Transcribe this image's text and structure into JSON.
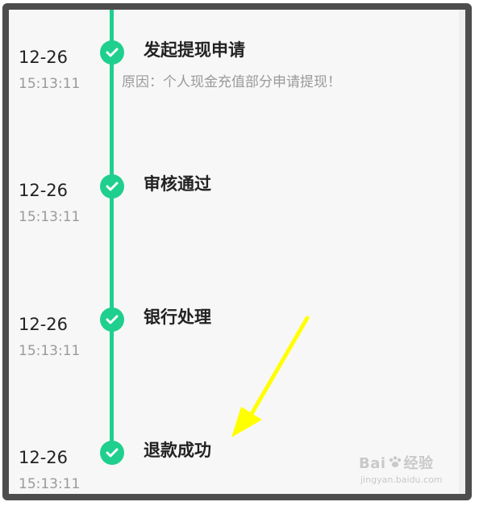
{
  "timeline": {
    "steps": [
      {
        "date": "12-26",
        "time": "15:13:11",
        "title": "发起提现申请",
        "reason": "原因：个人现金充值部分申请提现！"
      },
      {
        "date": "12-26",
        "time": "15:13:11",
        "title": "审核通过"
      },
      {
        "date": "12-26",
        "time": "15:13:11",
        "title": "银行处理"
      },
      {
        "date": "12-26",
        "time": "15:13:11",
        "title": "退款成功"
      }
    ],
    "accent_color": "#1fcf8e"
  },
  "annotation": {
    "arrow_color": "#ffff00"
  },
  "watermark": {
    "logo_text_left": "Bai",
    "logo_text_right": "经验",
    "sub_text": "jingyan.baidu.com"
  },
  "icons": {
    "node_icon": "check-icon",
    "annotation_icon": "arrow-icon",
    "watermark_icon": "paw-icon"
  }
}
